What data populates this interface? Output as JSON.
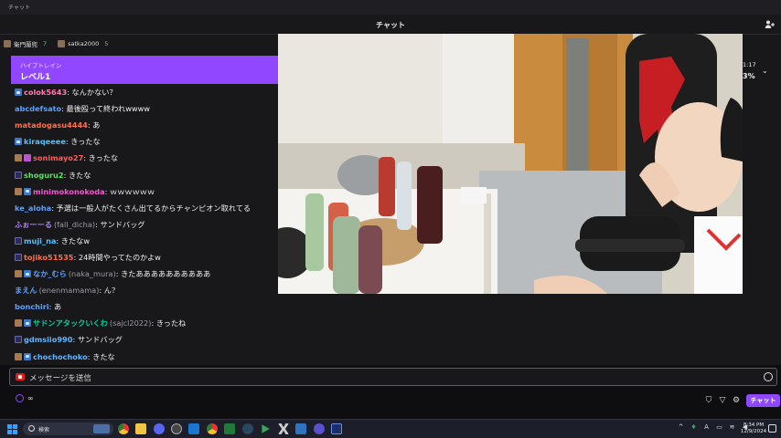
{
  "window": {
    "title": "チャット"
  },
  "header": {
    "title": "チャット"
  },
  "gift_bar": [
    {
      "name": "衛門蘭兜",
      "count": "7"
    },
    {
      "name": "satka2000",
      "count": "5"
    }
  ],
  "hype_train": {
    "subtitle": "ハイプトレイン",
    "level": "レベル1"
  },
  "messages": [
    {
      "badges": [
        "sub"
      ],
      "name": "colok5643",
      "alt": "",
      "color": "#ff7bac",
      "text": ": なんかない？"
    },
    {
      "badges": [],
      "name": "abcdefsato",
      "alt": "",
      "color": "#5aa0ff",
      "text": ": 最後殴って終われwwww"
    },
    {
      "badges": [],
      "name": "matadogasu4444",
      "alt": "",
      "color": "#ff6e4a",
      "text": ": あ"
    },
    {
      "badges": [
        "sub"
      ],
      "name": "kiraqeeee",
      "alt": "",
      "color": "#4fc3ff",
      "text": ": きったな"
    },
    {
      "badges": [
        "av",
        "gift"
      ],
      "name": "sonimayo27",
      "alt": "",
      "color": "#ff5c5c",
      "text": ": きったな"
    },
    {
      "badges": [
        "vid"
      ],
      "name": "shoguru2",
      "alt": "",
      "color": "#5fe05f",
      "text": ": きたな"
    },
    {
      "badges": [
        "av",
        "sub"
      ],
      "name": "minimokonokoda",
      "alt": "",
      "color": "#ff4fd8",
      "text": ": ｗｗｗｗｗｗ"
    },
    {
      "badges": [],
      "name": "ke_aloha",
      "alt": "",
      "color": "#5aa0ff",
      "text": ": 予選は一般人がたくさん出てるからチャンピオン取れてる"
    },
    {
      "badges": [],
      "name": "ふぉーーる",
      "alt": "(fall_dicha)",
      "color": "#b47cff",
      "text": ": サンドバッグ"
    },
    {
      "badges": [
        "vid"
      ],
      "name": "muji_na",
      "alt": "",
      "color": "#4fc3ff",
      "text": ": きたなw"
    },
    {
      "badges": [
        "vid"
      ],
      "name": "tojiko51535",
      "alt": "",
      "color": "#ff6e4a",
      "text": ": 24時間やってたのかよw"
    },
    {
      "badges": [
        "av",
        "sub"
      ],
      "name": "なか_むら",
      "alt": "(naka_mura)",
      "color": "#5aa0ff",
      "text": ": きたああああああああああ"
    },
    {
      "badges": [],
      "name": "まえん",
      "alt": "(enenmamama)",
      "color": "#5aa0ff",
      "text": ": ん？"
    },
    {
      "badges": [],
      "name": "bonchiri",
      "alt": "",
      "color": "#5aa0ff",
      "text": ": あ"
    },
    {
      "badges": [
        "av",
        "sub"
      ],
      "name": "サドンアタックいくわ",
      "alt": "(sajcl2022)",
      "color": "#00d0a0",
      "text": ": きったね"
    },
    {
      "badges": [
        "vid"
      ],
      "name": "gdmsiio990",
      "alt": "",
      "color": "#5fb4ff",
      "text": ": サンドバッグ"
    },
    {
      "badges": [
        "av",
        "sub"
      ],
      "name": "chochochoko",
      "alt": "",
      "color": "#5fb4ff",
      "text": ": きたな"
    }
  ],
  "side_counter": {
    "time": "1:17",
    "percent": "3%"
  },
  "input": {
    "placeholder": "メッセージを送信"
  },
  "points": {
    "value": "∞"
  },
  "chat_button": {
    "label": "チャット"
  },
  "taskbar": {
    "search_label": "検索",
    "clock_time": "8:34 PM",
    "clock_date": "12/9/2024",
    "tray_lang": "A"
  },
  "colors": {
    "accent": "#9147ff",
    "background": "#18181b"
  }
}
